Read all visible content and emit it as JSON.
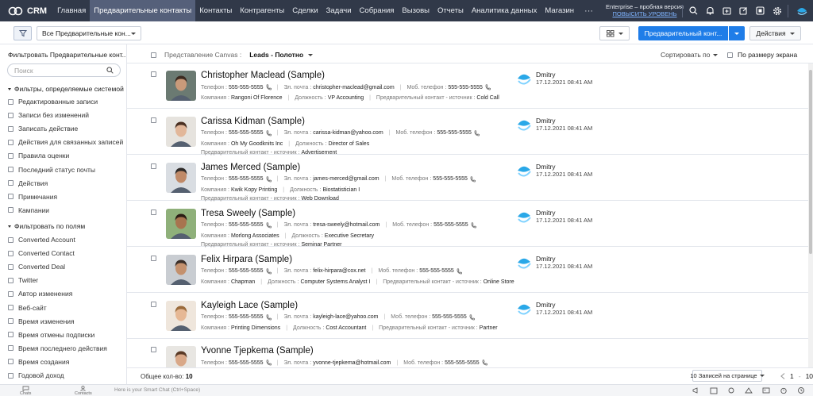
{
  "app": {
    "name": "CRM"
  },
  "nav": {
    "items": [
      "Главная",
      "Предварительные контакты",
      "Контакты",
      "Контрагенты",
      "Сделки",
      "Задачи",
      "Собрания",
      "Вызовы",
      "Отчеты",
      "Аналитика данных",
      "Магазин"
    ],
    "active_index": 1,
    "more": "···"
  },
  "trial": {
    "edition": "Enterprise – пробная версия",
    "upgrade": "ПОВЫСИТЬ УРОВЕНЬ"
  },
  "toolbar": {
    "view_select": "Все Предварительные кон...",
    "primary_button": "Предварительный конт...",
    "actions_button": "Действия"
  },
  "sidebar": {
    "title": "Фильтровать Предварительные конт...",
    "search_placeholder": "Поиск",
    "system_group": "Фильтры, определяемые системой",
    "system_filters": [
      "Редактированные записи",
      "Записи без изменений",
      "Записать действие",
      "Действия для связанных записей",
      "Правила оценки",
      "Последний статус почты",
      "Действия",
      "Примечания",
      "Кампании"
    ],
    "fields_group": "Фильтровать по полям",
    "field_filters": [
      "Converted Account",
      "Converted Contact",
      "Converted Deal",
      "Twitter",
      "Автор изменения",
      "Веб-сайт",
      "Время изменения",
      "Время отмены подписки",
      "Время последнего действия",
      "Время создания",
      "Годовой доход"
    ]
  },
  "list_header": {
    "canvas_label": "Представление Canvas :",
    "canvas_value": "Leads - Полотно",
    "sort_label": "Сортировать по",
    "fit_label": "По размеру экрана"
  },
  "labels": {
    "phone": "Телефон :",
    "email": "Эл. почта :",
    "mobile": "Моб. телефон :",
    "company": "Компания :",
    "title": "Должность :",
    "source": "Предварительный контакт - источник :"
  },
  "leads": [
    {
      "name": "Christopher Maclead (Sample)",
      "phone": "555-555-5555",
      "email": "christopher-maclead@gmail.com",
      "mobile": "555-555-5555",
      "company": "Rangoni Of Florence",
      "title": "VP Accounting",
      "source": "Cold Call",
      "owner": "Dmitry",
      "date": "17.12.2021 08:41 AM",
      "avatar": {
        "bg": "#6b7a72",
        "skin": "#c99a7a",
        "hair": "#3b2a20"
      }
    },
    {
      "name": "Carissa Kidman (Sample)",
      "phone": "555-555-5555",
      "email": "carissa-kidman@yahoo.com",
      "mobile": "555-555-5555",
      "company": "Oh My Goodknits Inc",
      "title": "Director of Sales",
      "source": "Advertisement",
      "owner": "Dmitry",
      "date": "17.12.2021 08:41 AM",
      "avatar": {
        "bg": "#e6e3de",
        "skin": "#e2b79a",
        "hair": "#4a3022"
      }
    },
    {
      "name": "James Merced (Sample)",
      "phone": "555-555-5555",
      "email": "james-merced@gmail.com",
      "mobile": "555-555-5555",
      "company": "Kwik Kopy Printing",
      "title": "Biostatistician I",
      "source": "Web Download",
      "owner": "Dmitry",
      "date": "17.12.2021 08:41 AM",
      "avatar": {
        "bg": "#d9dde2",
        "skin": "#c08a68",
        "hair": "#2e2a28"
      }
    },
    {
      "name": "Tresa Sweely (Sample)",
      "phone": "555-555-5555",
      "email": "tresa-sweely@hotmail.com",
      "mobile": "555-555-5555",
      "company": "Morlong Associates",
      "title": "Executive Secretary",
      "source": "Seminar Partner",
      "owner": "Dmitry",
      "date": "17.12.2021 08:41 AM",
      "avatar": {
        "bg": "#8fb07a",
        "skin": "#a8744f",
        "hair": "#2a1c14"
      }
    },
    {
      "name": "Felix Hirpara (Sample)",
      "phone": "555-555-5555",
      "email": "felix-hirpara@cox.net",
      "mobile": "555-555-5555",
      "company": "Chapman",
      "title": "Computer Systems Analyst I",
      "source": "Online Store",
      "owner": "Dmitry",
      "date": "17.12.2021 08:41 AM",
      "avatar": {
        "bg": "#c9cdd2",
        "skin": "#c4916e",
        "hair": "#3a2e28"
      }
    },
    {
      "name": "Kayleigh Lace (Sample)",
      "phone": "555-555-5555",
      "email": "kayleigh-lace@yahoo.com",
      "mobile": "555-555-5555",
      "company": "Printing Dimensions",
      "title": "Cost Accountant",
      "source": "Partner",
      "owner": "Dmitry",
      "date": "17.12.2021 08:41 AM",
      "avatar": {
        "bg": "#efe6dc",
        "skin": "#e6b895",
        "hair": "#9a6a3a"
      }
    },
    {
      "name": "Yvonne Tjepkema (Sample)",
      "phone": "555-555-5555",
      "email": "yvonne-tjepkema@hotmail.com",
      "mobile": "555-555-5555",
      "company": "",
      "title": "",
      "source": "",
      "owner": "",
      "date": "",
      "avatar": {
        "bg": "#e8e6e2",
        "skin": "#d9a888",
        "hair": "#5a3a26"
      }
    }
  ],
  "footer": {
    "total_label": "Общее кол-во:",
    "total_value": "10",
    "per_page": "10 Записей на странице",
    "page_from": "1",
    "page_to": "10"
  },
  "bottombar": {
    "chats": "Chats",
    "contacts": "Contacts",
    "chat_placeholder": "Here is your Smart Chat (Ctrl+Space)"
  },
  "colors": {
    "topbar": "#313949",
    "nav_active": "#55607a",
    "primary": "#1f7de8",
    "owner_icon": "#2aa8e8"
  }
}
